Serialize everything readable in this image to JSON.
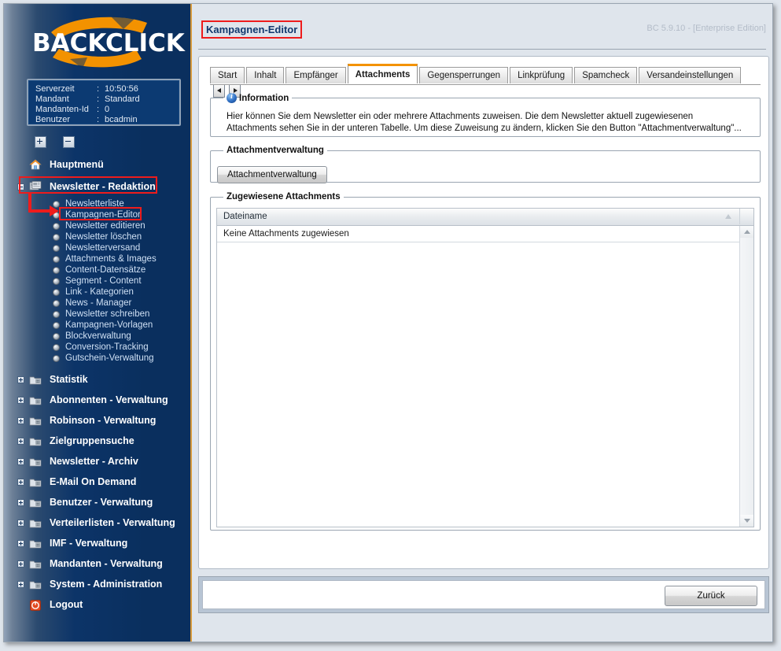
{
  "window": {
    "version_label": "BC 5.9.10 - [Enterprise Edition]",
    "page_title": "Kampagnen-Editor"
  },
  "sidebar": {
    "logo": "BACKCLICK",
    "info": [
      {
        "label": "Serverzeit",
        "sep": ":",
        "value": "10:50:56"
      },
      {
        "label": "Mandant",
        "sep": ":",
        "value": "Standard"
      },
      {
        "label": "Mandanten-Id",
        "sep": ":",
        "value": "0"
      },
      {
        "label": "Benutzer",
        "sep": ":",
        "value": "bcadmin"
      }
    ],
    "tree_buttons": [
      {
        "name": "expand-all-button",
        "glyph": "+"
      },
      {
        "name": "collapse-all-button",
        "glyph": "-"
      }
    ],
    "nav": [
      {
        "label": "Hauptmenü",
        "icon": "home-icon",
        "expander": null,
        "highlight": false
      },
      {
        "label": "Newsletter - Redaktion",
        "icon": "newsletter-icon",
        "expander": "minus",
        "highlight": true
      },
      {
        "label": "Statistik",
        "icon": "folder-icon",
        "expander": "plus",
        "highlight": false
      },
      {
        "label": "Abonnenten - Verwaltung",
        "icon": "folder-icon",
        "expander": "plus",
        "highlight": false
      },
      {
        "label": "Robinson - Verwaltung",
        "icon": "folder-icon",
        "expander": "plus",
        "highlight": false
      },
      {
        "label": "Zielgruppensuche",
        "icon": "folder-icon",
        "expander": "plus",
        "highlight": false
      },
      {
        "label": "Newsletter - Archiv",
        "icon": "folder-icon",
        "expander": "plus",
        "highlight": false
      },
      {
        "label": "E-Mail On Demand",
        "icon": "folder-icon",
        "expander": "plus",
        "highlight": false
      },
      {
        "label": "Benutzer - Verwaltung",
        "icon": "folder-icon",
        "expander": "plus",
        "highlight": false
      },
      {
        "label": "Verteilerlisten - Verwaltung",
        "icon": "folder-icon",
        "expander": "plus",
        "highlight": false
      },
      {
        "label": "IMF - Verwaltung",
        "icon": "folder-icon",
        "expander": "plus",
        "highlight": false
      },
      {
        "label": "Mandanten - Verwaltung",
        "icon": "folder-icon",
        "expander": "plus",
        "highlight": false
      },
      {
        "label": "System - Administration",
        "icon": "folder-icon",
        "expander": "plus",
        "highlight": false
      },
      {
        "label": "Logout",
        "icon": "logout-icon",
        "expander": null,
        "highlight": false
      }
    ],
    "submenu": [
      "Newsletterliste",
      "Kampagnen-Editor",
      "Newsletter editieren",
      "Newsletter löschen",
      "Newsletterversand",
      "Attachments & Images",
      "Content-Datensätze",
      "Segment - Content",
      "Link - Kategorien",
      "News - Manager",
      "Newsletter schreiben",
      "Kampagnen-Vorlagen",
      "Blockverwaltung",
      "Conversion-Tracking",
      "Gutschein-Verwaltung"
    ],
    "selected_submenu": "Kampagnen-Editor"
  },
  "tabs": [
    {
      "label": "Start",
      "active": false
    },
    {
      "label": "Inhalt",
      "active": false
    },
    {
      "label": "Empfänger",
      "active": false
    },
    {
      "label": "Attachments",
      "active": true
    },
    {
      "label": "Gegensperrungen",
      "active": false
    },
    {
      "label": "Linkprüfung",
      "active": false
    },
    {
      "label": "Spamcheck",
      "active": false
    },
    {
      "label": "Versandeinstellungen",
      "active": false
    }
  ],
  "info_panel": {
    "legend": "Information",
    "text": "Hier können Sie dem Newsletter ein oder mehrere Attachments zuweisen. Die dem Newsletter aktuell zugewiesenen Attachments sehen Sie in der unteren Tabelle. Um diese Zuweisung zu ändern, klicken Sie den Button \"Attachmentverwaltung\"..."
  },
  "attachment_management": {
    "legend": "Attachmentverwaltung",
    "button_label": "Attachmentverwaltung"
  },
  "assigned_attachments": {
    "legend": "Zugewiesene Attachments",
    "columns": [
      "Dateiname"
    ],
    "rows": [
      [
        "Keine Attachments zugewiesen"
      ]
    ]
  },
  "footer": {
    "back_label": "Zurück"
  },
  "colors": {
    "sidebar_dark": "#0a2f5e",
    "sidebar_accent": "#d79a3c",
    "logo_orange": "#f39200",
    "title_blue": "#11386e",
    "annotation_red": "#ee1c1c",
    "active_tab_top": "#f39200",
    "page_background": "#dfe5ec"
  }
}
